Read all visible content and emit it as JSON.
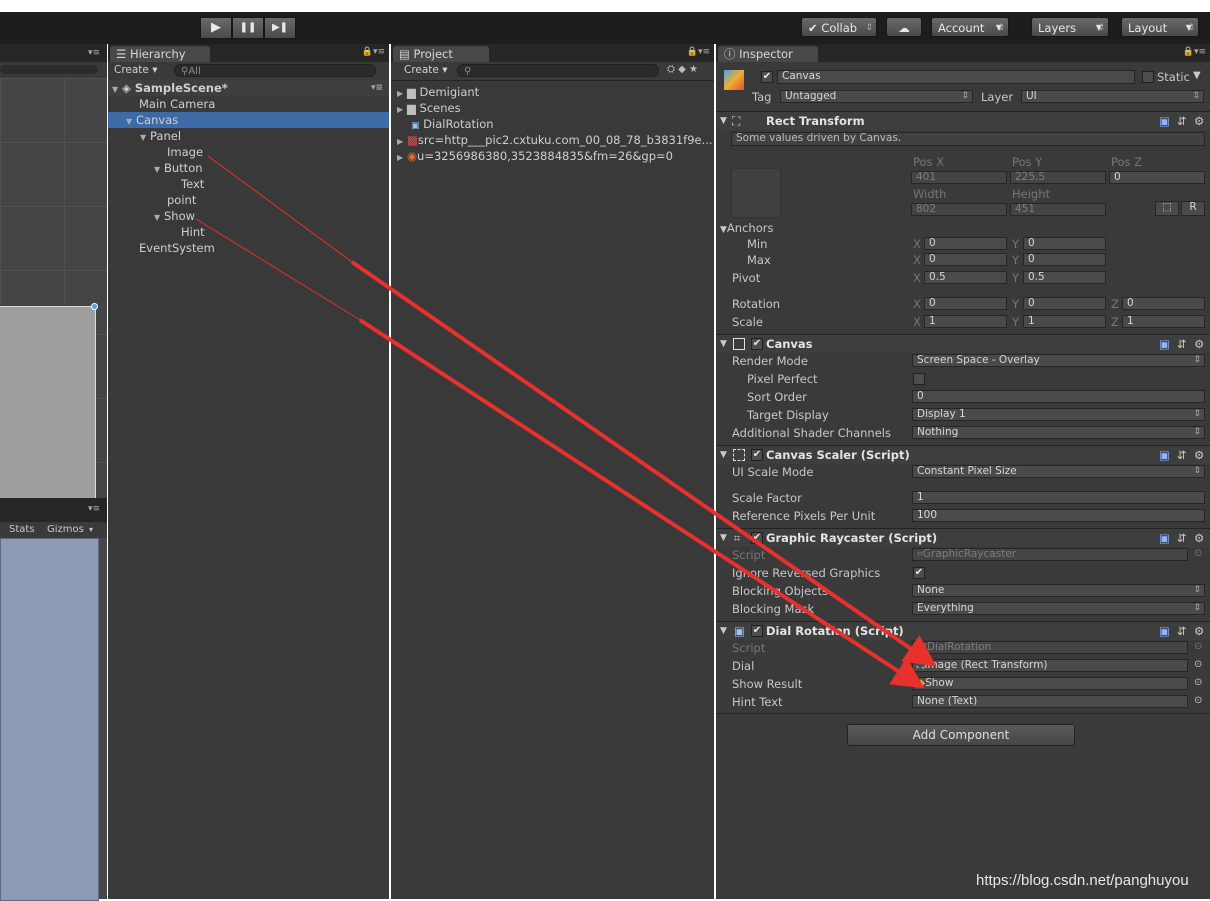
{
  "toolbar": {
    "collab": "Collab",
    "account": "Account",
    "layers": "Layers",
    "layout": "Layout",
    "play": "▶",
    "pause": "❚❚",
    "step": "▶❚"
  },
  "scene_view": {
    "stats": "Stats",
    "gizmos": "Gizmos"
  },
  "hierarchy": {
    "tab": "Hierarchy",
    "create": "Create",
    "search_placeholder": "All",
    "scene": "SampleScene*",
    "items": [
      "Main Camera",
      "Canvas",
      "Panel",
      "Image",
      "Button",
      "Text",
      "point",
      "Show",
      "Hint",
      "EventSystem"
    ]
  },
  "project": {
    "tab": "Project",
    "create": "Create",
    "items": [
      "Demigiant",
      "Scenes",
      "DialRotation",
      "src=http___pic2.cxtuku.com_00_08_78_b3831f9e...",
      "u=3256986380,3523884835&fm=26&gp=0"
    ]
  },
  "inspector": {
    "tab": "Inspector",
    "object_name": "Canvas",
    "static_label": "Static",
    "tag_label": "Tag",
    "tag_value": "Untagged",
    "layer_label": "Layer",
    "layer_value": "UI",
    "rect": {
      "title": "Rect Transform",
      "note": "Some values driven by Canvas.",
      "posx_label": "Pos X",
      "posy_label": "Pos Y",
      "posz_label": "Pos Z",
      "posx": "401",
      "posy": "225.5",
      "posz": "0",
      "width_label": "Width",
      "height_label": "Height",
      "width": "802",
      "height": "451",
      "r_label": "R",
      "anchors_label": "Anchors",
      "min_label": "Min",
      "max_label": "Max",
      "min_x": "0",
      "min_y": "0",
      "max_x": "0",
      "max_y": "0",
      "pivot_label": "Pivot",
      "pivot_x": "0.5",
      "pivot_y": "0.5",
      "rotation_label": "Rotation",
      "rot_x": "0",
      "rot_y": "0",
      "rot_z": "0",
      "scale_label": "Scale",
      "scale_x": "1",
      "scale_y": "1",
      "scale_z": "1",
      "x": "X",
      "y": "Y",
      "z": "Z"
    },
    "canvas": {
      "title": "Canvas",
      "render_mode_label": "Render Mode",
      "render_mode": "Screen Space - Overlay",
      "pixel_perfect_label": "Pixel Perfect",
      "sort_order_label": "Sort Order",
      "sort_order": "0",
      "target_display_label": "Target Display",
      "target_display": "Display 1",
      "shader_channels_label": "Additional Shader Channels",
      "shader_channels": "Nothing"
    },
    "scaler": {
      "title": "Canvas Scaler (Script)",
      "ui_scale_mode_label": "UI Scale Mode",
      "ui_scale_mode": "Constant Pixel Size",
      "scale_factor_label": "Scale Factor",
      "scale_factor": "1",
      "ref_ppu_label": "Reference Pixels Per Unit",
      "ref_ppu": "100"
    },
    "raycaster": {
      "title": "Graphic Raycaster (Script)",
      "script_label": "Script",
      "script": "GraphicRaycaster",
      "ignore_label": "Ignore Reversed Graphics",
      "blocking_objects_label": "Blocking Objects",
      "blocking_objects": "None",
      "blocking_mask_label": "Blocking Mask",
      "blocking_mask": "Everything"
    },
    "dial": {
      "title": "Dial Rotation (Script)",
      "script_label": "Script",
      "script": "DialRotation",
      "dial_label": "Dial",
      "dial": "Image (Rect Transform)",
      "show_result_label": "Show Result",
      "show_result": "Show",
      "hint_text_label": "Hint Text",
      "hint_text": "None (Text)"
    },
    "add_component": "Add Component"
  },
  "watermark": "https://blog.csdn.net/panghuyou",
  "colors": {
    "selection": "#3d6ba8",
    "arrow": "#e8302c"
  }
}
